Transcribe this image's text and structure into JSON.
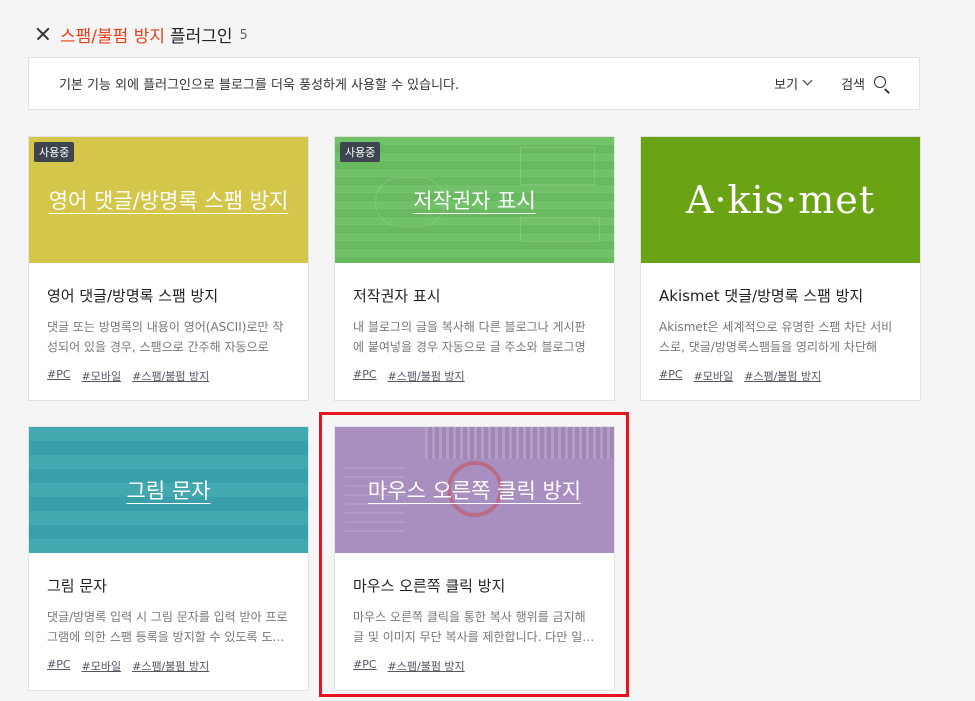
{
  "header": {
    "category": "스팸/불펌 방지",
    "title_suffix": "플러그인",
    "count": "5"
  },
  "infobar": {
    "text": "기본 기능 외에 플러그인으로 블로그를 더욱 풍성하게 사용할 수 있습니다.",
    "view_label": "보기",
    "search_label": "검색"
  },
  "cards": [
    {
      "thumb_title": "영어 댓글/방명록 스팸 방지",
      "badge": "사용중",
      "title": "영어 댓글/방명록 스팸 방지",
      "desc": "댓글 또는 방명록의 내용이 영어(ASCII)로만 작성되어 있을 경우, 스팸으로 간주해 자동으로 차…",
      "tags": [
        "#PC",
        "#모바일",
        "#스팸/불펌 방지"
      ],
      "color": "#d4c64a"
    },
    {
      "thumb_title": "저작권자 표시",
      "badge": "사용중",
      "title": "저작권자 표시",
      "desc": "내 블로그의 글을 복사해 다른 블로그나 게시판에 붙여넣을 경우 자동으로 글 주소와 블로그명에…",
      "tags": [
        "#PC",
        "#스팸/불펌 방지"
      ],
      "color": "#6bbf63"
    },
    {
      "thumb_logo": "A·kis·met",
      "title": "Akismet 댓글/방명록 스팸 방지",
      "desc": "Akismet은 세계적으로 유명한 스팸 차단 서비스로, 댓글/방명록스팸들을 영리하게 차단해 쾌…",
      "tags": [
        "#PC",
        "#모바일",
        "#스팸/불펌 방지"
      ],
      "color": "#6aa314"
    },
    {
      "thumb_title": "그림 문자",
      "title": "그림 문자",
      "desc": "댓글/방명록 입력 시 그림 문자를 입력 받아 프로그램에 의한 스팸 등록을 방지할 수 있도록 도…",
      "tags": [
        "#PC",
        "#모바일",
        "#스팸/불펌 방지"
      ],
      "color": "#3aa3ad"
    },
    {
      "thumb_title": "마우스 오른쪽 클릭 방지",
      "title": "마우스 오른쪽 클릭 방지",
      "desc": "마우스 오른쪽 클릭을 통한 복사 행위를 금지해 글 및 이미지 무단 복사를 제한합니다. 다만 일…",
      "tags": [
        "#PC",
        "#스팸/불펌 방지"
      ],
      "color": "#a98fbf"
    }
  ]
}
